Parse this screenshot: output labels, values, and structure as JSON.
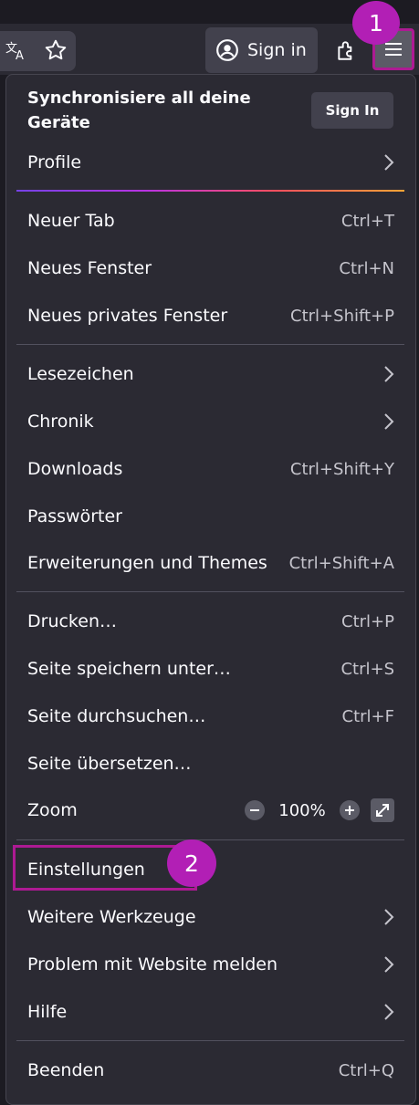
{
  "toolbar": {
    "signin_label": "Sign in"
  },
  "callouts": {
    "first": "1",
    "second": "2"
  },
  "menu": {
    "sync_title": "Synchronisiere all deine Geräte",
    "sync_button": "Sign In",
    "profile": "Profile",
    "new_tab": {
      "label": "Neuer Tab",
      "shortcut": "Ctrl+T"
    },
    "new_window": {
      "label": "Neues Fenster",
      "shortcut": "Ctrl+N"
    },
    "new_private_window": {
      "label": "Neues privates Fenster",
      "shortcut": "Ctrl+Shift+P"
    },
    "bookmarks": "Lesezeichen",
    "history": "Chronik",
    "downloads": {
      "label": "Downloads",
      "shortcut": "Ctrl+Shift+Y"
    },
    "passwords": "Passwörter",
    "addons": {
      "label": "Erweiterungen und Themes",
      "shortcut": "Ctrl+Shift+A"
    },
    "print": {
      "label": "Drucken…",
      "shortcut": "Ctrl+P"
    },
    "save_page": {
      "label": "Seite speichern unter…",
      "shortcut": "Ctrl+S"
    },
    "find_in_page": {
      "label": "Seite durchsuchen…",
      "shortcut": "Ctrl+F"
    },
    "translate_page": "Seite übersetzen…",
    "zoom": {
      "label": "Zoom",
      "value": "100%"
    },
    "settings": "Einstellungen",
    "more_tools": "Weitere Werkzeuge",
    "report_site": "Problem mit Website melden",
    "help": "Hilfe",
    "quit": {
      "label": "Beenden",
      "shortcut": "Ctrl+Q"
    }
  },
  "colors": {
    "background": "#1c1b22",
    "panel": "#2b2a33",
    "button": "#42414d",
    "highlight": "#ad1a93",
    "callout": "#b21fb5"
  }
}
